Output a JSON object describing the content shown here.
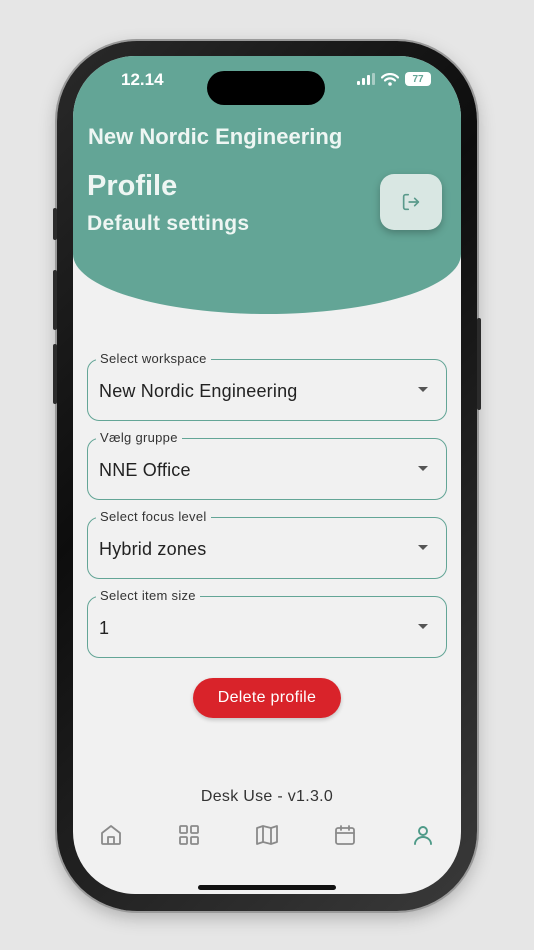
{
  "status_bar": {
    "time": "12.14",
    "battery": "77"
  },
  "header": {
    "org_name": "New Nordic Engineering",
    "title": "Profile",
    "subtitle": "Default settings",
    "logout_icon": "logout-icon"
  },
  "fields": [
    {
      "label": "Select workspace",
      "value": "New Nordic Engineering"
    },
    {
      "label": "Vælg gruppe",
      "value": "NNE Office"
    },
    {
      "label": "Select focus level",
      "value": "Hybrid zones"
    },
    {
      "label": "Select item size",
      "value": "1"
    }
  ],
  "delete_button": {
    "label": "Delete profile"
  },
  "version": "Desk Use - v1.3.0",
  "nav": {
    "items": [
      "home-icon",
      "grid-icon",
      "map-icon",
      "calendar-icon",
      "person-icon"
    ],
    "active": "person-icon"
  },
  "colors": {
    "accent": "#63a596",
    "danger": "#d9232a",
    "inactive_icon": "#8a8a8a"
  }
}
